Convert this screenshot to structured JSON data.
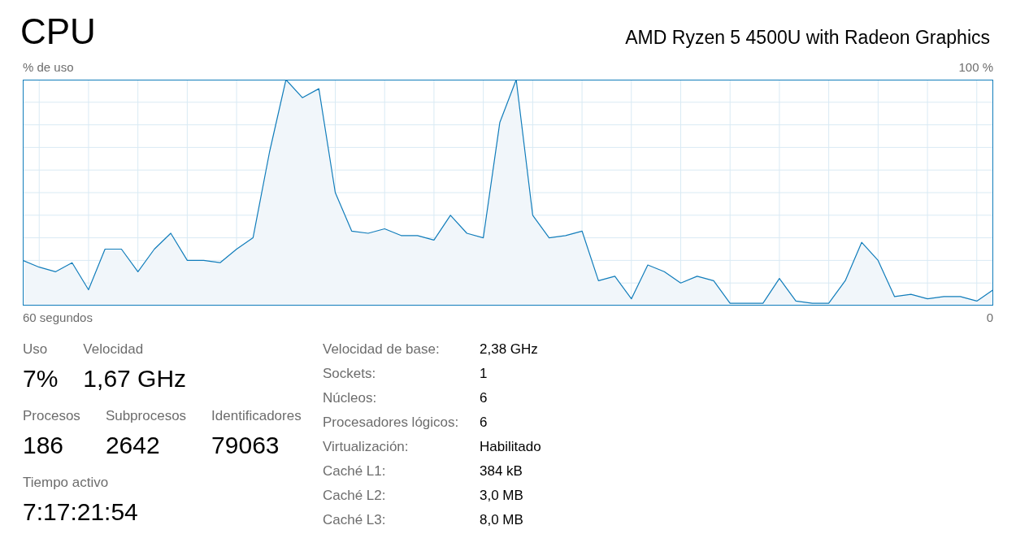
{
  "header": {
    "title": "CPU",
    "processor": "AMD Ryzen 5 4500U with Radeon Graphics"
  },
  "graph": {
    "label": "% de uso",
    "max_label": "100 %",
    "start_label": "60 segundos",
    "end_label": "0"
  },
  "stats": [
    [
      {
        "label": "Uso",
        "value": "7%"
      },
      {
        "label": "Velocidad",
        "value": "1,67 GHz"
      }
    ],
    [
      {
        "label": "Procesos",
        "value": "186"
      },
      {
        "label": "Subprocesos",
        "value": "2642"
      },
      {
        "label": "Identificadores",
        "value": "79063"
      }
    ],
    [
      {
        "label": "Tiempo activo",
        "value": "7:17:21:54"
      }
    ]
  ],
  "details": [
    {
      "label": "Velocidad de base:",
      "value": "2,38 GHz"
    },
    {
      "label": "Sockets:",
      "value": "1"
    },
    {
      "label": "Núcleos:",
      "value": "6"
    },
    {
      "label": "Procesadores lógicos:",
      "value": "6"
    },
    {
      "label": "Virtualización:",
      "value": "Habilitado"
    },
    {
      "label": "Caché L1:",
      "value": "384 kB"
    },
    {
      "label": "Caché L2:",
      "value": "3,0 MB"
    },
    {
      "label": "Caché L3:",
      "value": "8,0 MB"
    }
  ]
}
